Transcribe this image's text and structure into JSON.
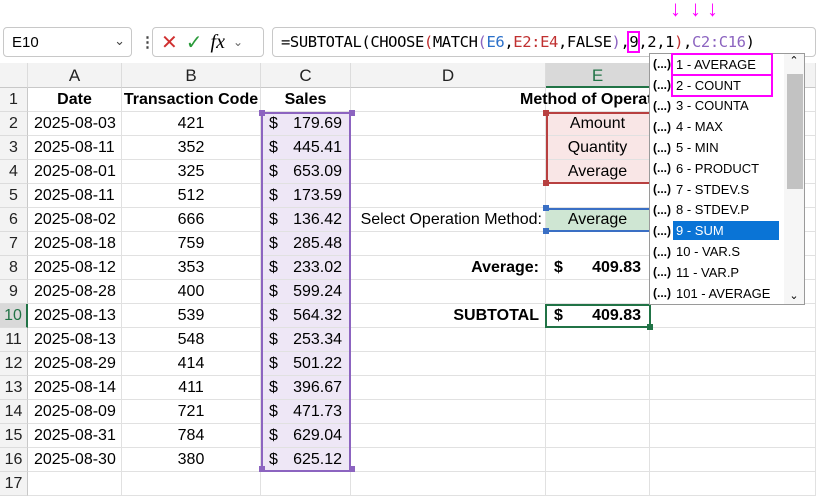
{
  "formula_bar": {
    "name_box": "E10",
    "cancel_icon": "✕",
    "enter_icon": "✓",
    "fx_label": "fx",
    "formula_parts": [
      {
        "t": "=SUBTOTAL(CHOOSE",
        "c": "#000"
      },
      {
        "t": "(",
        "c": "#c03030"
      },
      {
        "t": "MATCH",
        "c": "#000"
      },
      {
        "t": "(",
        "c": "#8c64c0"
      },
      {
        "t": "E6",
        "c": "#2a6fc9"
      },
      {
        "t": ",",
        "c": "#000"
      },
      {
        "t": "E2:E4",
        "c": "#c03030"
      },
      {
        "t": ",FALSE",
        "c": "#000"
      },
      {
        "t": ")",
        "c": "#8c64c0"
      },
      {
        "t": ",",
        "c": "#000"
      },
      {
        "t": "9",
        "c": "#000",
        "hl": true
      },
      {
        "t": ",2,1",
        "c": "#000"
      },
      {
        "t": ")",
        "c": "#c03030"
      },
      {
        "t": ",",
        "c": "#000"
      },
      {
        "t": "C2:C16",
        "c": "#8c64c0"
      },
      {
        "t": ")",
        "c": "#000"
      }
    ]
  },
  "columns": [
    "A",
    "B",
    "C",
    "D",
    "E"
  ],
  "rows": [
    "1",
    "2",
    "3",
    "4",
    "5",
    "6",
    "7",
    "8",
    "9",
    "10",
    "11",
    "12",
    "13",
    "14",
    "15",
    "16",
    "17"
  ],
  "headers": {
    "date": "Date",
    "code": "Transaction Code",
    "sales": "Sales",
    "method": "Method of Operat"
  },
  "data": [
    [
      "2025-08-03",
      "421",
      "179.69"
    ],
    [
      "2025-08-11",
      "352",
      "445.41"
    ],
    [
      "2025-08-01",
      "325",
      "653.09"
    ],
    [
      "2025-08-11",
      "512",
      "173.59"
    ],
    [
      "2025-08-02",
      "666",
      "136.42"
    ],
    [
      "2025-08-18",
      "759",
      "285.48"
    ],
    [
      "2025-08-12",
      "353",
      "233.02"
    ],
    [
      "2025-08-28",
      "400",
      "599.24"
    ],
    [
      "2025-08-13",
      "539",
      "564.32"
    ],
    [
      "2025-08-13",
      "548",
      "253.34"
    ],
    [
      "2025-08-29",
      "414",
      "501.22"
    ],
    [
      "2025-08-14",
      "411",
      "396.67"
    ],
    [
      "2025-08-09",
      "721",
      "471.73"
    ],
    [
      "2025-08-31",
      "784",
      "629.04"
    ],
    [
      "2025-08-30",
      "380",
      "625.12"
    ]
  ],
  "currency": "$",
  "methods": [
    "Amount",
    "Quantity",
    "Average"
  ],
  "select_label": "Select Operation Method:",
  "select_value": "Average",
  "average_label": "Average:",
  "average_value": "409.83",
  "subtotal_label": "SUBTOTAL",
  "subtotal_value": "409.83",
  "dropdown": {
    "icon": "(...)",
    "items": [
      "1 - AVERAGE",
      "2 - COUNT",
      "3 - COUNTA",
      "4 - MAX",
      "5 - MIN",
      "6 - PRODUCT",
      "7 - STDEV.S",
      "8 - STDEV.P",
      "9 - SUM",
      "10 - VAR.S",
      "11 - VAR.P",
      "101 - AVERAGE"
    ],
    "active": 8,
    "marked": [
      0,
      1
    ]
  },
  "arrow_glyph": "↓"
}
